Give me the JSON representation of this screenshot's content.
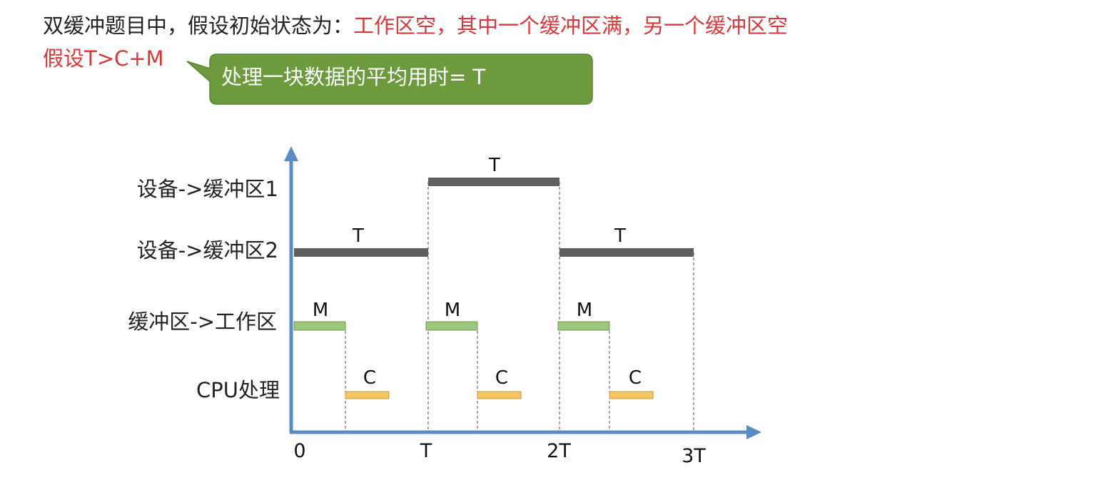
{
  "header": {
    "lead": "双缓冲题目中，假设初始状态为：",
    "highlight": "工作区空，其中一个缓冲区满，另一个缓冲区空",
    "assumption": "假设T>C+M"
  },
  "callout": {
    "text": "处理一块数据的平均用时= T",
    "color": "#6e9a3e"
  },
  "rows": {
    "dev_buf1": "设备->缓冲区1",
    "dev_buf2": "设备->缓冲区2",
    "buf_work": "缓冲区->工作区",
    "cpu": "CPU处理"
  },
  "x_axis": {
    "ticks": [
      "0",
      "T",
      "2T",
      "3T"
    ]
  },
  "bar_labels": {
    "T": "T",
    "M": "M",
    "C": "C"
  },
  "colors": {
    "axis": "#5b8bc4",
    "device_bar": "#5f5f5f",
    "transfer_bar": "#9cc77c",
    "cpu_bar": "#f3c565",
    "highlight_text": "#d9383a"
  }
}
